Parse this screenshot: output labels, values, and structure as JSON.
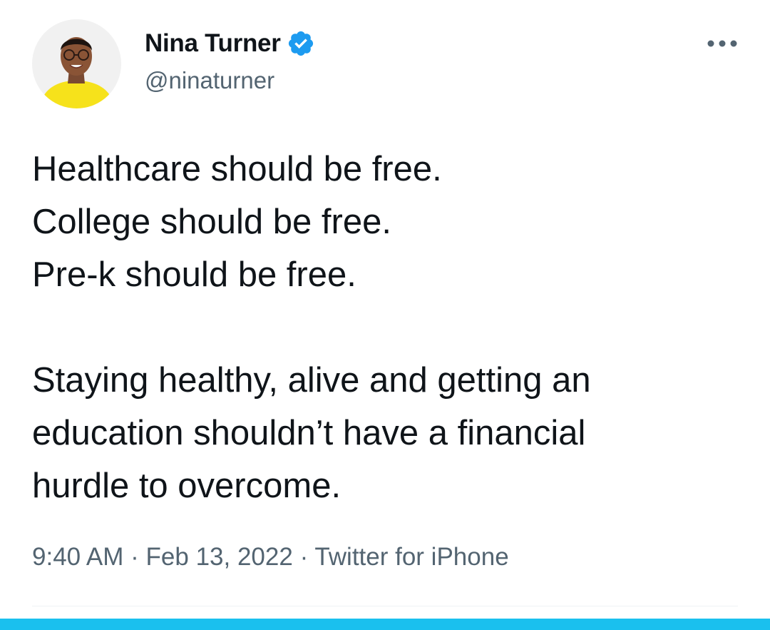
{
  "author": {
    "display_name": "Nina Turner",
    "handle": "@ninaturner",
    "verified": true
  },
  "tweet": {
    "lines": [
      "Healthcare should be free.",
      "College should be free.",
      "Pre-k should be free.",
      "Staying healthy, alive and getting an",
      "education shouldn’t have a financial",
      "hurdle to overcome."
    ]
  },
  "meta": {
    "time": "9:40 AM",
    "separator": "·",
    "date": "Feb 13, 2022",
    "source": "Twitter for iPhone"
  },
  "colors": {
    "verified_badge": "#1d9bf0",
    "secondary_text": "#536471",
    "accent_bar": "#1ac0ee",
    "avatar_shirt": "#f6e21b"
  },
  "icons": {
    "verified": "verified-badge-icon",
    "more": "more-dots-icon"
  }
}
